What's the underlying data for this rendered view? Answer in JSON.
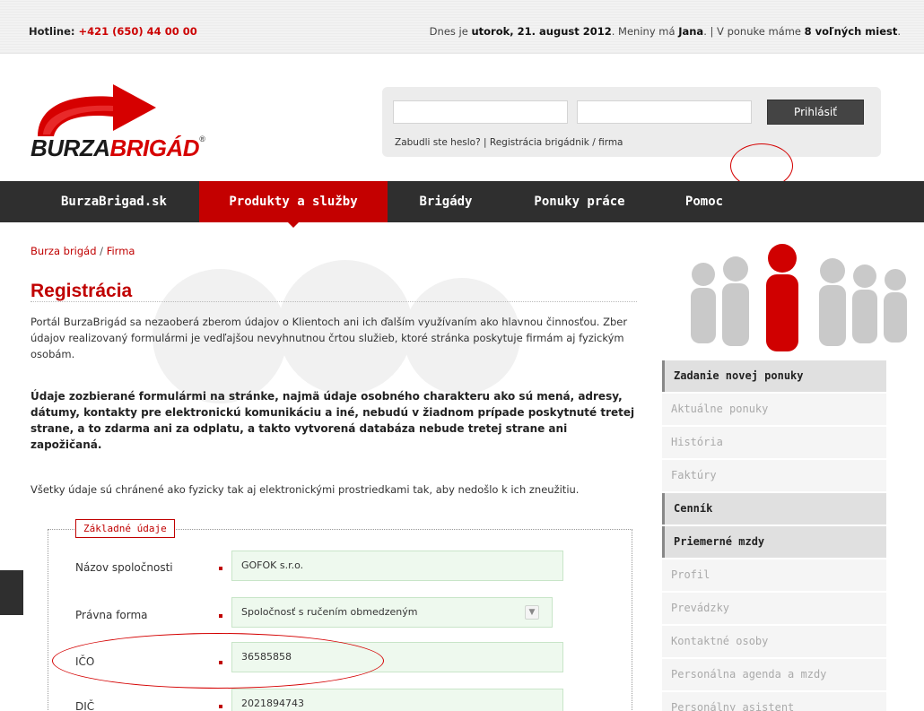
{
  "topbar": {
    "hotline_label": "Hotline:",
    "hotline_number": "+421 (650) 44 00 00",
    "today_prefix": "Dnes je ",
    "today_date": "utorok, 21. august 2012",
    "today_mid": ". Meniny má ",
    "today_name": "Jana",
    "today_sep": ". | V ponuke máme ",
    "today_count": "8 voľných miest",
    "today_end": "."
  },
  "logo": {
    "word_a": "BURZA",
    "word_b": "BRIGÁD",
    "reg": "®"
  },
  "login": {
    "button": "Prihlásiť",
    "forgot": "Zabudli ste heslo?",
    "sep": " | ",
    "register": "Registrácia brigádnik / firma"
  },
  "nav": {
    "items": [
      "BurzaBrigad.sk",
      "Produkty a služby",
      "Brigády",
      "Ponuky práce",
      "Pomoc"
    ],
    "active": "Produkty a služby"
  },
  "breadcrumb": {
    "home": "Burza brigád",
    "sep": " / ",
    "current": "Firma"
  },
  "title": "Registrácia",
  "intro": "Portál BurzaBrigád sa nezaoberá zberom údajov o Klientoch ani ich ďalším využívaním ako hlavnou činnosťou. Zber údajov realizovaný formulármi je vedľajšou nevyhnutnou črtou služieb, ktoré stránka poskytuje firmám aj fyzickým osobám.",
  "notice": "Údaje zozbierané formulármi na stránke, najmä údaje osobného charakteru ako sú mená, adresy, dátumy, kontakty pre elektronickú komunikáciu a iné, nebudú v žiadnom prípade poskytnuté tretej strane, a to zdarma ani za odplatu, a takto vytvorená databáza nebude tretej strane ani zapožičaná.",
  "protection": "Všetky údaje sú chránené ako fyzicky tak aj elektronickými prostriedkami tak, aby nedošlo k ich zneužitiu.",
  "form": {
    "legend": "Základné údaje",
    "fields": [
      {
        "label": "Názov spoločnosti",
        "value": "GOFOK s.r.o."
      },
      {
        "label": "Právna forma",
        "value": "Spoločnosť s ručením obmedzeným"
      },
      {
        "label": "IČO",
        "value": "36585858"
      },
      {
        "label": "DIČ",
        "value": "2021894743"
      }
    ]
  },
  "sidebar": {
    "items": [
      {
        "label": "Zadanie novej ponuky",
        "strong": true
      },
      {
        "label": "Aktuálne ponuky",
        "strong": false
      },
      {
        "label": "História",
        "strong": false
      },
      {
        "label": "Faktúry",
        "strong": false
      },
      {
        "label": "Cenník",
        "strong": true
      },
      {
        "label": "Priemerné mzdy",
        "strong": true
      },
      {
        "label": "Profil",
        "strong": false
      },
      {
        "label": "Prevádzky",
        "strong": false
      },
      {
        "label": "Kontaktné osoby",
        "strong": false
      },
      {
        "label": "Personálna agenda a mzdy",
        "strong": false
      },
      {
        "label": "Personálny asistent",
        "strong": false
      }
    ]
  },
  "colors": {
    "brand_red": "#c40000",
    "nav_bg": "#2f2f2f",
    "field_bg": "#eef9ee"
  }
}
